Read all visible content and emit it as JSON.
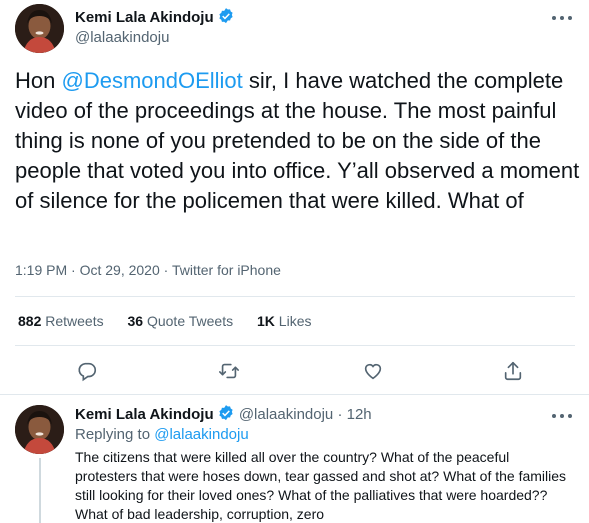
{
  "tweet": {
    "author_name": "Kemi Lala Akindoju",
    "author_handle": "@lalaakindoju",
    "text_prefix": "Hon ",
    "mention": "@DesmondOElliot",
    "text_suffix": " sir, I have watched the complete video of the proceedings at the house. The most painful thing is none of you pretended to be on the side of the people that voted you into office. Y’all observed a moment of silence for the policemen that were killed. What of",
    "time": "1:19 PM",
    "date": "Oct 29, 2020",
    "separator": "·",
    "source": "Twitter for iPhone"
  },
  "stats": {
    "retweets_count": "882",
    "retweets_label": "Retweets",
    "quotes_count": "36",
    "quotes_label": "Quote Tweets",
    "likes_count": "1K",
    "likes_label": "Likes"
  },
  "actions": [
    "reply-icon",
    "retweet-icon",
    "like-icon",
    "share-icon"
  ],
  "reply": {
    "author_name": "Kemi Lala Akindoju",
    "author_handle": "@lalaakindoju",
    "separator": "·",
    "time": "12h",
    "replying_prefix": "Replying to",
    "replying_handle": "@lalaakindoju",
    "text": "The citizens that were killed all over the country? What of the peaceful protesters that were hoses down, tear gassed and shot at? What of the families still looking for their loved ones? What of the palliatives that were hoarded?? What of bad leadership, corruption, zero"
  },
  "colors": {
    "accent": "#1d9bf0",
    "secondary_text": "#536471",
    "primary_text": "#0f1419"
  }
}
